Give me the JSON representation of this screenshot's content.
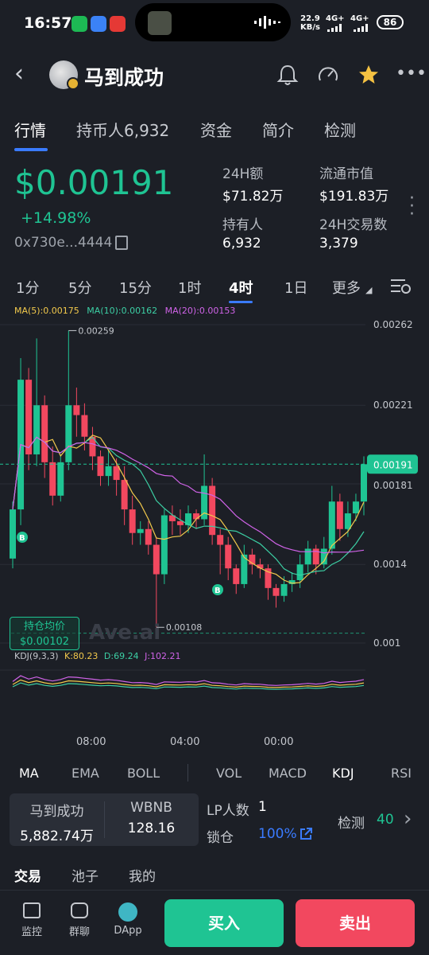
{
  "status_bar": {
    "time": "16:57",
    "net_speed_value": "22.9",
    "net_speed_unit": "KB/s",
    "network_1": "4G+",
    "network_2": "4G+",
    "battery": "86"
  },
  "header": {
    "title": "马到成功",
    "icons": [
      "back-icon",
      "bell-icon",
      "gauge-icon",
      "star-icon",
      "more-icon"
    ]
  },
  "tabs": [
    {
      "label": "行情",
      "active": true
    },
    {
      "label": "持币人6,932"
    },
    {
      "label": "资金"
    },
    {
      "label": "简介"
    },
    {
      "label": "检测"
    }
  ],
  "price": {
    "value": "$0.00191",
    "change": "+14.98%",
    "address": "0x730e...4444"
  },
  "stats": {
    "volume_label": "24H额",
    "volume_value": "$71.82万",
    "mcap_label": "流通市值",
    "mcap_value": "$191.83万",
    "holders_label": "持有人",
    "holders_value": "6,932",
    "txns_label": "24H交易数",
    "txns_value": "3,379"
  },
  "intervals": [
    {
      "label": "1分"
    },
    {
      "label": "5分"
    },
    {
      "label": "15分"
    },
    {
      "label": "1时"
    },
    {
      "label": "4时",
      "active": true
    },
    {
      "label": "1日"
    },
    {
      "label": "更多"
    }
  ],
  "chart_data": {
    "type": "candlestick",
    "ma_legend": {
      "ma5": "MA(5):0.00175",
      "ma10": "MA(10):0.00162",
      "ma20": "MA(20):0.00153"
    },
    "y_ticks": [
      "0.00262",
      "0.00221",
      "0.00181",
      "0.0014",
      "0.001"
    ],
    "current_price_label": "0.00191",
    "high_label": "0.00259",
    "low_label": "0.00108",
    "avg_cost_label": "持仓均价",
    "avg_cost_value": "$0.00102",
    "watermark": "Ave.ai",
    "buy_marker": "B",
    "kdj_legend": {
      "name": "KDJ(9,3,3)",
      "k": "K:80.23",
      "d": "D:69.24",
      "j": "J:102.21"
    },
    "x_ticks": [
      "08:00",
      "04:00",
      "00:00"
    ],
    "candles": [
      [
        0.00143,
        0.00168,
        0.00138,
        0.00172
      ],
      [
        0.00168,
        0.00234,
        0.0016,
        0.00245
      ],
      [
        0.00234,
        0.00196,
        0.00188,
        0.0024
      ],
      [
        0.00196,
        0.00221,
        0.0019,
        0.00255
      ],
      [
        0.00221,
        0.00192,
        0.00184,
        0.00226
      ],
      [
        0.00192,
        0.00175,
        0.0017,
        0.002
      ],
      [
        0.00175,
        0.00192,
        0.00172,
        0.00196
      ],
      [
        0.00192,
        0.00221,
        0.00188,
        0.00259
      ],
      [
        0.00221,
        0.00216,
        0.00205,
        0.0023
      ],
      [
        0.00216,
        0.00205,
        0.00198,
        0.00222
      ],
      [
        0.00205,
        0.00195,
        0.00188,
        0.0021
      ],
      [
        0.00195,
        0.00185,
        0.0018,
        0.00198
      ],
      [
        0.00185,
        0.0019,
        0.0018,
        0.00198
      ],
      [
        0.0019,
        0.00183,
        0.00175,
        0.00194
      ],
      [
        0.00183,
        0.00168,
        0.0016,
        0.0019
      ],
      [
        0.00168,
        0.00156,
        0.0015,
        0.00175
      ],
      [
        0.00156,
        0.00158,
        0.0015,
        0.00162
      ],
      [
        0.00158,
        0.0015,
        0.00145,
        0.00162
      ],
      [
        0.0015,
        0.00135,
        0.00108,
        0.00154
      ],
      [
        0.00135,
        0.00165,
        0.0013,
        0.00168
      ],
      [
        0.00165,
        0.00162,
        0.00155,
        0.0017
      ],
      [
        0.00162,
        0.0016,
        0.00155,
        0.00168
      ],
      [
        0.0016,
        0.00166,
        0.00156,
        0.0017
      ],
      [
        0.00166,
        0.00163,
        0.00158,
        0.00168
      ],
      [
        0.00163,
        0.0018,
        0.0016,
        0.00196
      ],
      [
        0.0018,
        0.00155,
        0.0015,
        0.00184
      ],
      [
        0.00155,
        0.0015,
        0.00135,
        0.00158
      ],
      [
        0.0015,
        0.00138,
        0.00132,
        0.00154
      ],
      [
        0.00138,
        0.0013,
        0.00125,
        0.0014
      ],
      [
        0.0013,
        0.00145,
        0.00128,
        0.0015
      ],
      [
        0.00145,
        0.0014,
        0.00135,
        0.00148
      ],
      [
        0.0014,
        0.00138,
        0.00133,
        0.00143
      ],
      [
        0.00138,
        0.00128,
        0.00122,
        0.0014
      ],
      [
        0.00128,
        0.00124,
        0.00118,
        0.0013
      ],
      [
        0.00124,
        0.0013,
        0.00121,
        0.00134
      ],
      [
        0.0013,
        0.00132,
        0.00126,
        0.00136
      ],
      [
        0.00132,
        0.0014,
        0.00128,
        0.00145
      ],
      [
        0.0014,
        0.00148,
        0.00136,
        0.00152
      ],
      [
        0.00148,
        0.0014,
        0.00135,
        0.0015
      ],
      [
        0.0014,
        0.00148,
        0.00138,
        0.00154
      ],
      [
        0.00148,
        0.00172,
        0.00145,
        0.0018
      ],
      [
        0.00172,
        0.00158,
        0.00152,
        0.00176
      ],
      [
        0.00158,
        0.00166,
        0.00154,
        0.00172
      ],
      [
        0.00166,
        0.00172,
        0.00162,
        0.00176
      ],
      [
        0.00172,
        0.00191,
        0.00165,
        0.00195
      ]
    ]
  },
  "indicators": [
    {
      "label": "MA",
      "active": true
    },
    {
      "label": "EMA"
    },
    {
      "label": "BOLL"
    },
    {
      "label": "VOL"
    },
    {
      "label": "MACD"
    },
    {
      "label": "KDJ",
      "active": true
    },
    {
      "label": "RSI"
    }
  ],
  "pair": {
    "token_name": "马到成功",
    "token_amount": "5,882.74万",
    "quote_name": "WBNB",
    "quote_amount": "128.16"
  },
  "lp": {
    "holders_label": "LP人数",
    "holders_value": "1",
    "lock_label": "锁仓",
    "lock_value": "100%"
  },
  "check": {
    "label": "检测",
    "value": "40"
  },
  "sub_tabs": [
    {
      "label": "交易",
      "active": true
    },
    {
      "label": "池子"
    },
    {
      "label": "我的"
    }
  ],
  "bottom_nav": [
    {
      "label": "监控",
      "icon": "monitor-icon"
    },
    {
      "label": "群聊",
      "icon": "chat-icon"
    },
    {
      "label": "DApp",
      "icon": "pancake-icon"
    }
  ],
  "actions": {
    "buy_label": "买入",
    "sell_label": "卖出",
    "buy_color": "#1fc493",
    "sell_color": "#f2485f"
  },
  "colors": {
    "up": "#1fc493",
    "down": "#f2485f",
    "ma5": "#f2c94c",
    "ma10": "#3ccfa4",
    "ma20": "#d063e8",
    "accent": "#3a7bff"
  }
}
